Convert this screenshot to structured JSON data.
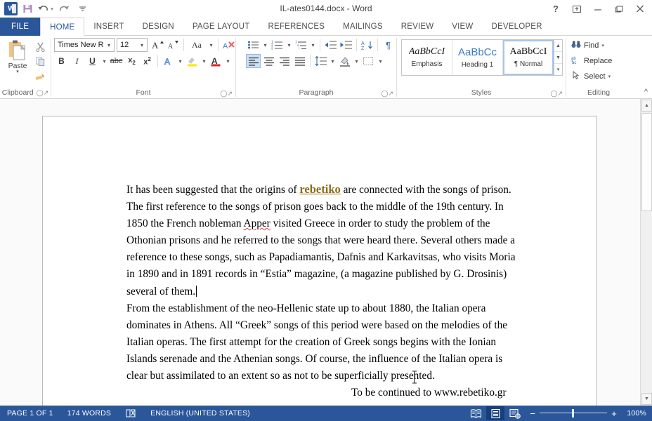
{
  "window": {
    "title": "IL-ates0144.docx - Word",
    "quick_access": [
      {
        "name": "word-logo-icon",
        "label": "W"
      },
      {
        "name": "save-icon",
        "label": "Save"
      },
      {
        "name": "undo-icon",
        "label": "Undo"
      },
      {
        "name": "redo-icon",
        "label": "Redo"
      },
      {
        "name": "customize-quick-access-icon",
        "label": "Customize Quick Access Toolbar"
      }
    ],
    "controls": [
      {
        "name": "help-button",
        "glyph": "?"
      },
      {
        "name": "ribbon-display-options-button",
        "glyph": "⤒"
      },
      {
        "name": "minimize-button",
        "glyph": "—"
      },
      {
        "name": "restore-button",
        "glyph": "❐"
      },
      {
        "name": "close-button",
        "glyph": "✕"
      }
    ]
  },
  "tabs": [
    {
      "label": "FILE",
      "active": false,
      "file": true
    },
    {
      "label": "HOME",
      "active": true
    },
    {
      "label": "INSERT",
      "active": false
    },
    {
      "label": "DESIGN",
      "active": false
    },
    {
      "label": "PAGE LAYOUT",
      "active": false
    },
    {
      "label": "REFERENCES",
      "active": false
    },
    {
      "label": "MAILINGS",
      "active": false
    },
    {
      "label": "REVIEW",
      "active": false
    },
    {
      "label": "VIEW",
      "active": false
    },
    {
      "label": "DEVELOPER",
      "active": false
    }
  ],
  "ribbon": {
    "clipboard": {
      "label": "Clipboard",
      "paste_label": "Paste",
      "buttons": [
        "Cut",
        "Copy",
        "Format Painter"
      ]
    },
    "font": {
      "label": "Font",
      "font_name": "Times New Ro",
      "font_size": "12",
      "buttons_row1": [
        "Grow Font",
        "Shrink Font",
        "Change Case",
        "Clear All Formatting"
      ],
      "buttons_row2": [
        "Bold",
        "Italic",
        "Underline",
        "Strikethrough",
        "Subscript",
        "Superscript",
        "Text Effects",
        "Text Highlight Color",
        "Font Color"
      ]
    },
    "paragraph": {
      "label": "Paragraph",
      "buttons_row1": [
        "Bullets",
        "Numbering",
        "Multilevel List",
        "Decrease Indent",
        "Increase Indent",
        "Sort",
        "Show/Hide Paragraph Marks"
      ],
      "buttons_row2": [
        "Align Left",
        "Center",
        "Align Right",
        "Justify",
        "Line and Paragraph Spacing",
        "Shading",
        "Borders"
      ],
      "active_alignment": "Align Left"
    },
    "styles": {
      "label": "Styles",
      "items": [
        {
          "preview": "AaBbCcI",
          "name": "Emphasis",
          "selected": false
        },
        {
          "preview": "AaBbCс",
          "name": "Heading 1",
          "selected": false
        },
        {
          "preview": "AaBbCcI",
          "name": "¶ Normal",
          "selected": true
        }
      ]
    },
    "editing": {
      "label": "Editing",
      "items": [
        {
          "label": "Find",
          "icon": "binoculars-icon",
          "has_caret": true
        },
        {
          "label": "Replace",
          "icon": "replace-icon",
          "has_caret": false
        },
        {
          "label": "Select",
          "icon": "select-pointer-icon",
          "has_caret": true
        }
      ]
    },
    "collapse_label": "Collapse the Ribbon"
  },
  "document": {
    "paragraph1_part1": "It has been suggested that the origins of ",
    "keyword": "rebetiko",
    "paragraph1_part2": " are connected with the songs of prison. The first reference to the songs of prison goes back to the middle of the 19th century. In 1850 the French nobleman ",
    "misspelled_word": "Apper",
    "paragraph1_part3": " visited Greece in order to study the problem of the Othonian prisons and he referred to the songs that were heard there. Several others made a reference to these songs, such as Papadiamantis, Dafnis and Karkavitsas, who visits Moria in 1890 and in 1891 records in “Estia” magazine, (a magazine published by G. Drosinis) several of them.",
    "paragraph2": "From the establishment of the neo-Hellenic state up to about 1880, the Italian opera dominates in Athens. All “Greek” songs of this period were based on the melodies of the Italian operas. The first attempt for the creation of Greek songs begins with the Ionian Islands serenade and the Athenian songs. Of course, the influence of the Italian opera is clear but assimilated to an extent so as not to be superficially presented.",
    "closing": "To be continued to www.rebetiko.gr",
    "keyword_color": "#8c6c14",
    "spellcheck_color": "#e03b3b"
  },
  "status_bar": {
    "page": "PAGE 1 OF 1",
    "words": "174 WORDS",
    "proofing_icon": "proofing-errors-icon",
    "language": "ENGLISH (UNITED STATES)",
    "views": [
      {
        "name": "read-mode-button",
        "label": "Read Mode",
        "active": false
      },
      {
        "name": "print-layout-button",
        "label": "Print Layout",
        "active": true
      },
      {
        "name": "web-layout-button",
        "label": "Web Layout",
        "active": false
      }
    ],
    "zoom_out_label": "−",
    "zoom_in_label": "+",
    "zoom_level": "100%",
    "accent_color": "#2b579a"
  },
  "scrollbar": {
    "up_label": "▲",
    "down_label": "▼"
  }
}
